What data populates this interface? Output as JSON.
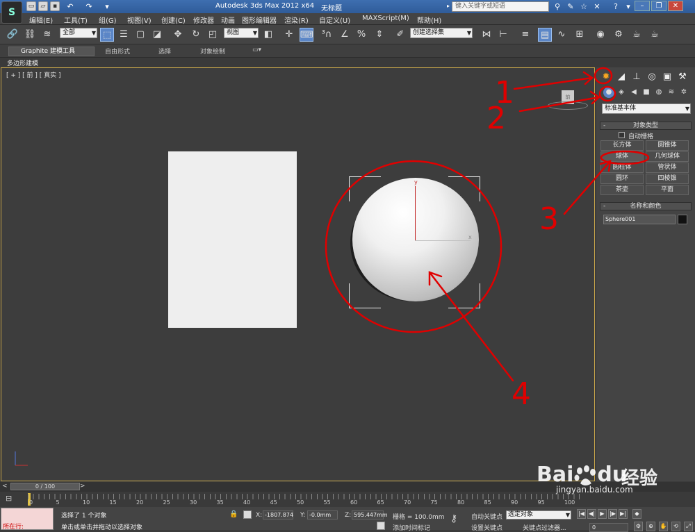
{
  "titlebar": {
    "app_logo": "S",
    "app_title": "Autodesk 3ds Max  2012 x64",
    "doc_title": "无标题",
    "search_placeholder": "键入关键字或短语"
  },
  "menubar": {
    "items": [
      "编辑(E)",
      "工具(T)",
      "组(G)",
      "视图(V)",
      "创建(C)",
      "修改器",
      "动画",
      "图形编辑器",
      "渲染(R)",
      "自定义(U)",
      "MAXScript(M)",
      "帮助(H)"
    ]
  },
  "toolbar": {
    "selection_filter": "全部",
    "ref_coord": "视图",
    "named_selection": "创建选择集"
  },
  "ribbon": {
    "tabs": [
      "Graphite 建模工具",
      "自由形式",
      "选择",
      "对象绘制"
    ],
    "sub_label": "多边形建模"
  },
  "viewport": {
    "label": "[ + ] [ 前 ] [ 真实 ]",
    "axis_y": "y",
    "axis_x": "x",
    "viewcube_label": "前"
  },
  "command_panel": {
    "category": "标准基本体",
    "object_type_title": "对象类型",
    "autogrid_label": "自动栅格",
    "buttons": [
      "长方体",
      "圆锥体",
      "球体",
      "几何球体",
      "圆柱体",
      "管状体",
      "圆环",
      "四棱锥",
      "茶壶",
      "平面"
    ],
    "name_color_title": "名称和颜色",
    "object_name": "Sphere001"
  },
  "timeline": {
    "frame_range": "0 / 100",
    "ticks": [
      "0",
      "5",
      "10",
      "15",
      "20",
      "25",
      "30",
      "35",
      "40",
      "45",
      "50",
      "55",
      "60",
      "65",
      "70",
      "75",
      "80",
      "85",
      "90",
      "95",
      "100"
    ]
  },
  "statusbar": {
    "script_label": "所在行:",
    "selected_text": "选择了 1 个对象",
    "hint_text": "单击或单击并拖动以选择对象",
    "x_label": "X:",
    "x_value": "-1807.874",
    "y_label": "Y:",
    "y_value": "-0.0mm",
    "z_label": "Z:",
    "z_value": "595.447mm",
    "grid": "栅格 = 100.0mm",
    "add_time_tag": "添加时间标记",
    "auto_key": "自动关键点",
    "selection_set": "选定对象",
    "set_key": "设置关键点",
    "key_filters": "关键点过滤器...",
    "current_frame": "0"
  },
  "annotations": {
    "labels": [
      "1",
      "2",
      "3",
      "4"
    ],
    "color": "#e00000"
  },
  "watermark": {
    "brand": "Bai",
    "brand_suffix": "du",
    "product": "经验",
    "url": "jingyan.baidu.com"
  }
}
